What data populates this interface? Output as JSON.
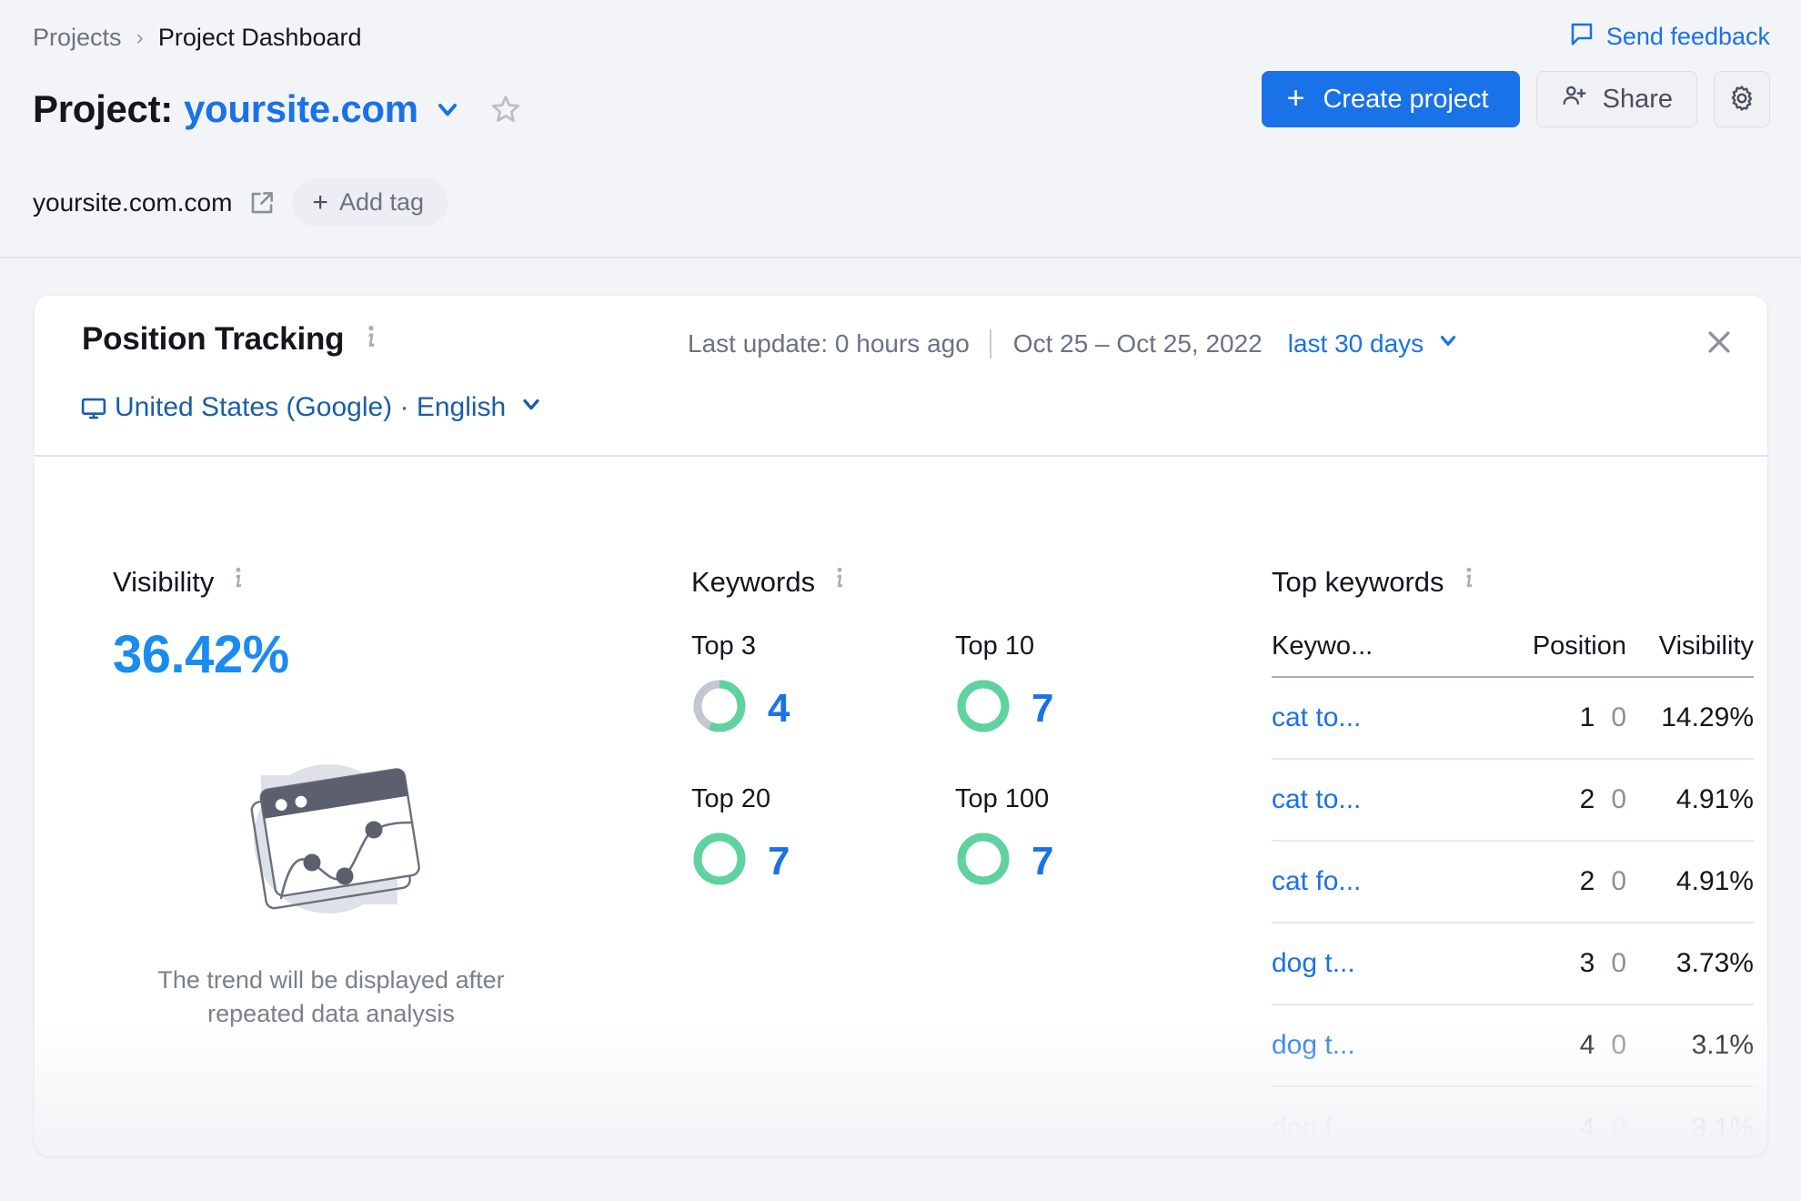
{
  "header": {
    "breadcrumb": {
      "root": "Projects",
      "separator": "›",
      "current": "Project Dashboard"
    },
    "feedback_label": "Send feedback",
    "title_prefix": "Project:",
    "title_site": "yoursite.com",
    "sub_domain": "yoursite.com.com",
    "add_tag_label": "Add tag",
    "add_tag_plus": "+",
    "create_project_label": "Create project",
    "create_project_plus": "+",
    "share_label": "Share"
  },
  "card": {
    "title": "Position Tracking",
    "last_update": "Last update: 0 hours ago",
    "date_range": "Oct 25 – Oct 25, 2022",
    "period": "last 30 days",
    "location": "United States (Google) · English"
  },
  "visibility": {
    "label": "Visibility",
    "value": "36.42%",
    "empty_caption": "The trend will be displayed after repeated data analysis"
  },
  "keywords": {
    "label": "Keywords",
    "items": [
      {
        "name": "Top 3",
        "value": "4",
        "pct": 57
      },
      {
        "name": "Top 10",
        "value": "7",
        "pct": 100
      },
      {
        "name": "Top 20",
        "value": "7",
        "pct": 100
      },
      {
        "name": "Top 100",
        "value": "7",
        "pct": 100
      }
    ]
  },
  "top_keywords": {
    "label": "Top keywords",
    "columns": [
      "Keywo...",
      "Position",
      "Visibility"
    ],
    "rows": [
      {
        "keyword": "cat to...",
        "position": "1",
        "diff": "0",
        "visibility": "14.29%"
      },
      {
        "keyword": "cat to...",
        "position": "2",
        "diff": "0",
        "visibility": "4.91%"
      },
      {
        "keyword": "cat fo...",
        "position": "2",
        "diff": "0",
        "visibility": "4.91%"
      },
      {
        "keyword": "dog t...",
        "position": "3",
        "diff": "0",
        "visibility": "3.73%"
      },
      {
        "keyword": "dog t...",
        "position": "4",
        "diff": "0",
        "visibility": "3.1%"
      },
      {
        "keyword": "dog f...",
        "position": "4",
        "diff": "0",
        "visibility": "3.1%"
      }
    ]
  },
  "colors": {
    "accent_blue": "#1a72e8",
    "value_blue": "#1a8cf0",
    "donut_green": "#5fd2a0",
    "donut_grey": "#c3c7d0",
    "page_bg": "#f3f4f7",
    "card_bg": "#ffffff",
    "text_dark": "#14161c",
    "text_muted": "#6c7284"
  },
  "icons": {
    "feedback": "speech-bubble-icon",
    "caret": "chevron-down-icon",
    "star": "star-outline-icon",
    "external": "external-link-icon",
    "share": "person-add-icon",
    "gear": "gear-icon",
    "info": "info-icon",
    "close": "close-icon",
    "monitor": "monitor-icon"
  }
}
